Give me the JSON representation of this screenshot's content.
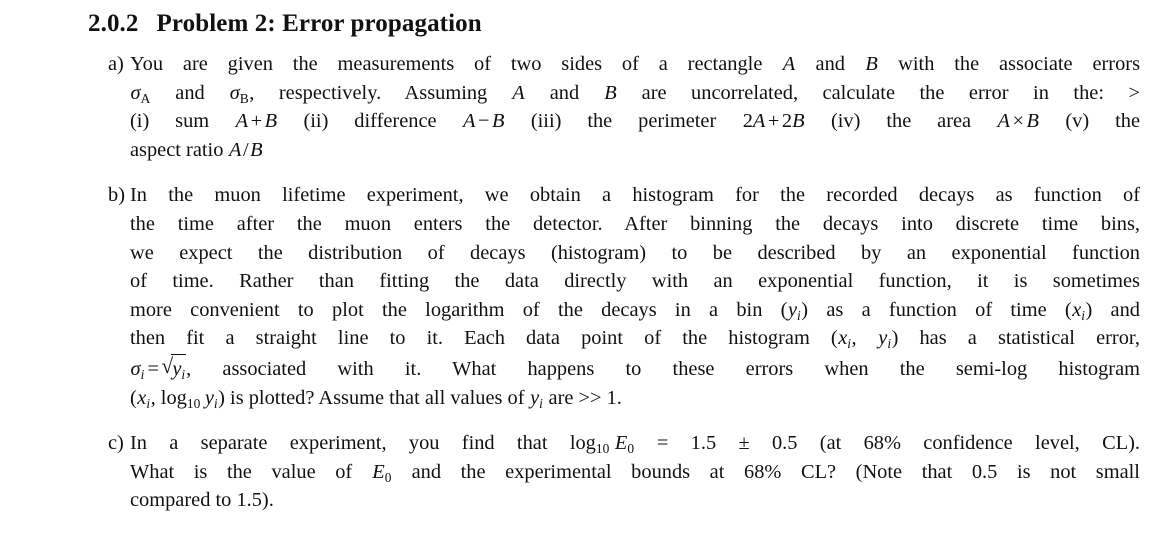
{
  "document": {
    "background_color": "#ffffff",
    "text_color": "#111111"
  },
  "heading": {
    "number": "2.0.2",
    "title": "Problem 2: Error propagation"
  },
  "problems": [
    {
      "label": "a)",
      "lines": [
        "You are given the measurements of two sides of a rectangle A and B with the associate errors",
        "σA and σB, respectively. Assuming A and B are uncorrelated, calculate the error in the: >",
        "(i) sum A + B (ii) difference A − B (iii) the perimeter 2A + 2B (iv) the area A × B (v) the",
        "aspect ratio A/B"
      ]
    },
    {
      "label": "b)",
      "lines": [
        "In the muon lifetime experiment, we obtain a histogram for the recorded decays as function of",
        "the time after the muon enters the detector. After binning the decays into discrete time bins,",
        "we expect the distribution of decays (histogram) to be described by an exponential function",
        "of time. Rather than fitting the data directly with an exponential function, it is sometimes",
        "more convenient to plot the logarithm of the decays in a bin (yᵢ) as a function of time (xᵢ) and",
        "then fit a straight line to it. Each data point of the histogram (xᵢ, yᵢ) has a statistical error,",
        "σᵢ = √yᵢ, associated with it. What happens to these errors when the semi-log histogram",
        "(xᵢ, log₁₀ yᵢ) is plotted? Assume that all values of yᵢ are >> 1."
      ]
    },
    {
      "label": "c)",
      "lines": [
        "In a separate experiment, you find that log₁₀ E₀ = 1.5 ± 0.5 (at 68% confidence level, CL).",
        "What is the value of E₀ and the experimental bounds at 68% CL? (Note that 0.5 is not small",
        "compared to 1.5)."
      ]
    }
  ],
  "math_tokens": {
    "variable_A": "A",
    "variable_B": "B",
    "sigma": "σ",
    "sigma_A": "σA",
    "sigma_B": "σB",
    "sigma_i": "σi",
    "y_i": "yi",
    "x_i": "xi",
    "E_0": "E0",
    "log_base": "10",
    "sum_expr": "A + B",
    "difference_expr": "A − B",
    "perimeter_expr": "2A + 2B",
    "area_expr": "A × B",
    "aspect_ratio_expr": "A/B",
    "sqrt_expr": "√yi",
    "log_E0_value": "1.5",
    "log_E0_error": "0.5",
    "confidence_level": "68%",
    "cl_abbrev": "CL",
    "much_greater": ">>",
    "much_greater_value": "1",
    "note_value": "1.5",
    "stray_caret": ">"
  },
  "text_fragments": {
    "a_l1_p1": "You are given the measurements of two sides of a rectangle ",
    "a_l1_p2": " and ",
    "a_l1_p3": " with the associate errors",
    "a_l2_p1": " and ",
    "a_l2_p2": ", respectively. Assuming ",
    "a_l2_p3": " and ",
    "a_l2_p4": " are uncorrelated, calculate the error in the: ",
    "a_l3_p1": "(i) sum ",
    "a_l3_p2": " (ii) difference ",
    "a_l3_p3": " (iii) the perimeter ",
    "a_l3_p4": " (iv) the area ",
    "a_l3_p5": " (v) the",
    "a_l4_p1": "aspect ratio ",
    "b_l1": "In the muon lifetime experiment, we obtain a histogram for the recorded decays as function of",
    "b_l2": "the time after the muon enters the detector. After binning the decays into discrete time bins,",
    "b_l3": "we expect the distribution of decays (histogram) to be described by an exponential function",
    "b_l4": "of time. Rather than fitting the data directly with an exponential function, it is sometimes",
    "b_l5_p1": "more convenient to plot the logarithm of the decays in a bin (",
    "b_l5_p2": ") as a function of time (",
    "b_l5_p3": ") and",
    "b_l6_p1": "then fit a straight line to it. Each data point of the histogram (",
    "b_l6_p2": ", ",
    "b_l6_p3": ") has a statistical error,",
    "b_l7_p1": ", associated with it. What happens to these errors when the semi-log histogram",
    "b_l8_p1": "(",
    "b_l8_p2": ", log",
    "b_l8_p3": ") is plotted? Assume that all values of ",
    "b_l8_p4": " are ",
    "b_l8_p5": " 1.",
    "c_l1_p1": "In a separate experiment, you find that log",
    "c_l1_p2": " = 1.5 ",
    "c_l1_p3": " 0.5 (at 68% confidence level, CL).",
    "c_l2_p1": "What is the value of ",
    "c_l2_p2": " and the experimental bounds at 68% CL? (Note that 0.5 is not small",
    "c_l3": "compared to 1.5)."
  }
}
